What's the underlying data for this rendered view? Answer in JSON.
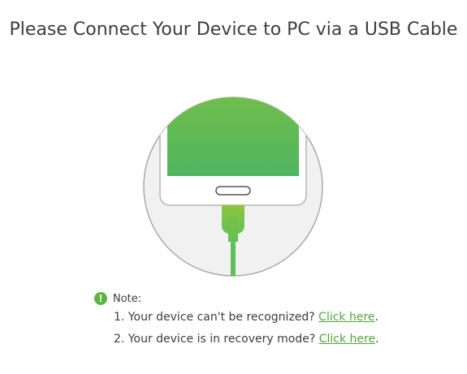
{
  "title": "Please Connect Your Device to PC via a USB Cable",
  "illustration": {
    "icon": "phone-usb-illustration",
    "screen_color_top": "#7dc243",
    "screen_color_bottom": "#4fb560",
    "cable_color": "#5fbf5a"
  },
  "note": {
    "icon": "exclamation-icon",
    "label": "Note:",
    "accent_color": "#5bb340",
    "items": [
      {
        "prefix": "1. Your device can't be recognized? ",
        "link": "Click here",
        "suffix": "."
      },
      {
        "prefix": "2. Your device is in recovery mode? ",
        "link": "Click here",
        "suffix": "."
      }
    ]
  }
}
